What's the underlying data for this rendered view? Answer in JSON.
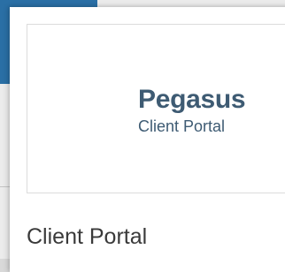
{
  "tile": {
    "logo": {
      "brand": "Pegasus",
      "tagline": "Client Portal"
    },
    "title": "Client Portal"
  },
  "colors": {
    "header_accent": "#2a6fa5",
    "logo_text": "#3e5b73",
    "title_text": "#3a3a3a"
  }
}
